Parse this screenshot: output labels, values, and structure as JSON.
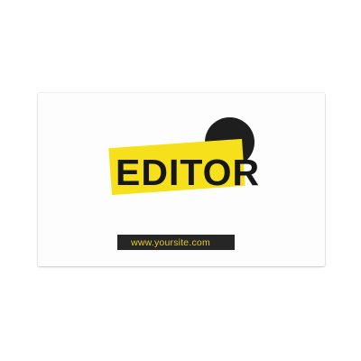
{
  "card": {
    "title": "EDITOR",
    "website": "www.yoursite.com"
  },
  "colors": {
    "accent_yellow": "#f6e01c",
    "dark": "#1e1e1e",
    "url_text": "#e2cb28",
    "card_background": "#fdfdfd"
  }
}
